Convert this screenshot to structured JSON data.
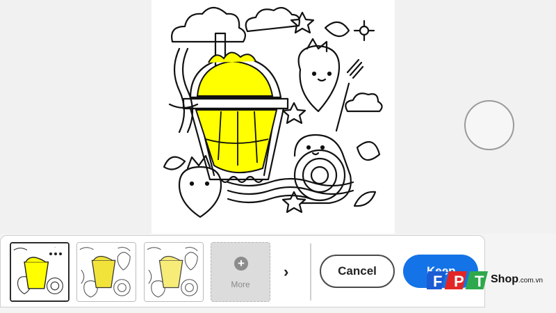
{
  "artwork": {
    "description_icon": "boba-doodle-artwork",
    "fill_color": "#ffff00",
    "line_color": "#111111"
  },
  "thumbnails": [
    {
      "label": "",
      "selected": true
    },
    {
      "label": "",
      "selected": false
    },
    {
      "label": "",
      "selected": false
    }
  ],
  "add_more": {
    "label": "More",
    "icon": "plus-circle-icon"
  },
  "next_arrow": "›",
  "actions": {
    "cancel_label": "Cancel",
    "keep_label": "Keep"
  },
  "watermark": {
    "brand": "FPT",
    "suffix_main": "Shop",
    "suffix_domain": ".com.vn",
    "colors": [
      "#1b5bd3",
      "#e32526",
      "#2ea84d"
    ]
  }
}
